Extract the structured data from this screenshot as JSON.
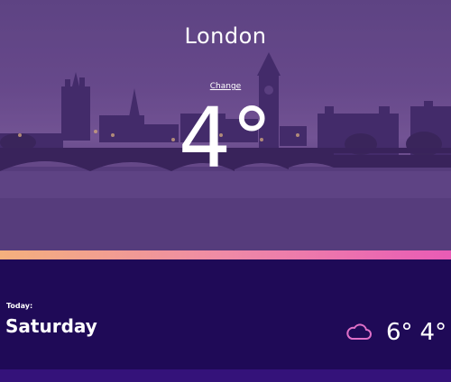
{
  "location": {
    "city": "London",
    "change_label": "Change"
  },
  "current": {
    "temperature": "4°"
  },
  "forecast": {
    "label": "Today:",
    "day": "Saturday",
    "icon": "cloud-icon",
    "high": "6°",
    "low": "4°"
  },
  "colors": {
    "panel": "#1f0a57",
    "accent_start": "#f4b07d",
    "accent_end": "#e95bb5",
    "icon": "#e070c8",
    "bottom_bar": "#34127a"
  }
}
